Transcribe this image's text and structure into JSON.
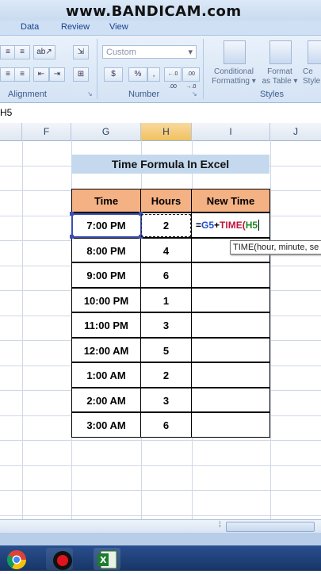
{
  "watermark": "www.BANDICAM.com",
  "ribbon": {
    "tabs": [
      "Data",
      "Review",
      "View"
    ],
    "number_format": "Custom",
    "currency_symbol": "$",
    "percent_symbol": "%",
    "comma_symbol": ",",
    "increase_decimal": "←.0 .00",
    "decrease_decimal": ".00 →.0",
    "groups": {
      "alignment": "Alignment",
      "number": "Number",
      "styles": "Styles"
    },
    "buttons": {
      "conditional_formatting_line1": "Conditional",
      "conditional_formatting_line2": "Formatting ▾",
      "format_table_line1": "Format",
      "format_table_line2": "as Table ▾",
      "cell_styles_line1": "Ce",
      "cell_styles_line2": "Style"
    }
  },
  "formula_bar": {
    "name_box": "H5"
  },
  "columns": [
    "F",
    "G",
    "H",
    "I",
    "J"
  ],
  "sheet": {
    "title": "Time Formula In Excel",
    "headers": {
      "time": "Time",
      "hours": "Hours",
      "new_time": "New Time"
    },
    "rows": [
      {
        "time": "7:00 PM",
        "hours": "2"
      },
      {
        "time": "8:00 PM",
        "hours": "4"
      },
      {
        "time": "9:00 PM",
        "hours": "6"
      },
      {
        "time": "10:00 PM",
        "hours": "1"
      },
      {
        "time": "11:00 PM",
        "hours": "3"
      },
      {
        "time": "12:00 AM",
        "hours": "5"
      },
      {
        "time": "1:00 AM",
        "hours": "2"
      },
      {
        "time": "2:00 AM",
        "hours": "3"
      },
      {
        "time": "3:00 AM",
        "hours": "6"
      }
    ],
    "formula": {
      "eq": "=",
      "ref1": "G5",
      "plus": "+",
      "fn": "TIME(",
      "ref2": "H5"
    },
    "tooltip": "TIME(hour, minute, se"
  },
  "colors": {
    "header_fill": "#f4b183",
    "title_fill": "#c5d9ee",
    "ref1_color": "#1f4fd1",
    "ref2_color": "#1e8a20",
    "function_color": "#c0143c"
  }
}
